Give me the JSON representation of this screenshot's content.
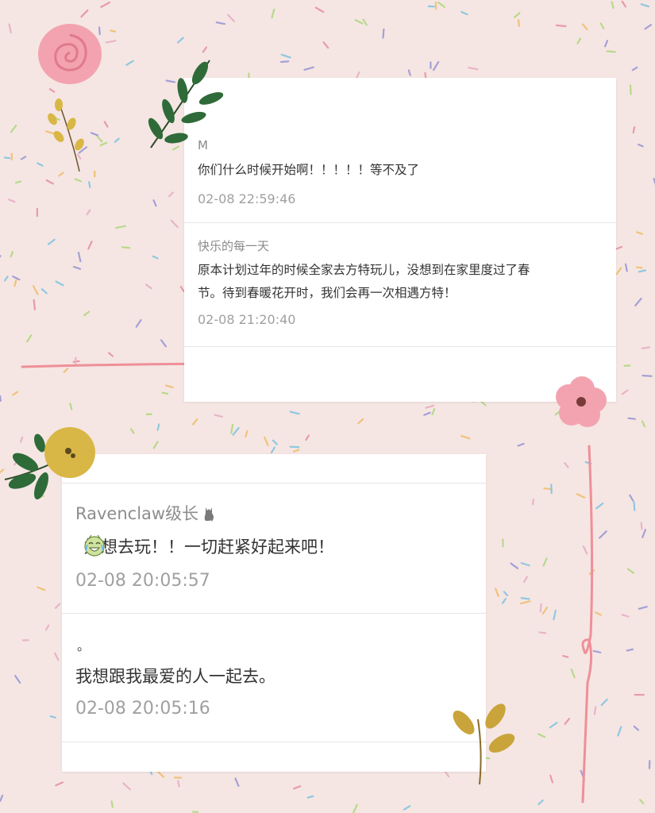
{
  "colors": {
    "background": "#f5e6e3",
    "card": "#ffffff",
    "confetti": [
      "#e89aa8",
      "#8fc8e0",
      "#b7d98a",
      "#a4a0d6",
      "#f0c27a",
      "#e8b4c8"
    ],
    "pink_line": "#ef8f98",
    "flower_pink": "#f3a3b0",
    "flower_yellow": "#d9b746",
    "leaf_green": "#2f6b38",
    "leaf_gold": "#c9a43a"
  },
  "icons": {
    "author_badge": "cat-icon",
    "emoji": "crying-laughing-face-icon"
  },
  "comments_top": [
    {
      "author": "M",
      "text": "你们什么时候开始啊！！！！！等不及了",
      "time": "02-08 22:59:46"
    },
    {
      "author": "快乐的每一天",
      "text_line1": "原本计划过年的时候全家去方特玩儿，没想到在家里度过了春",
      "text_line2": "节。待到春暖花开时，我们会再一次相遇方特！",
      "time": "02-08 21:20:40"
    }
  ],
  "comments_bottom": [
    {
      "author": "Ravenclaw级长",
      "text": "好想去玩！！一切赶紧好起来吧！",
      "time": "02-08 20:05:57"
    },
    {
      "author": "。",
      "text": "我想跟我最爱的人一起去。",
      "time": "02-08 20:05:16"
    }
  ]
}
